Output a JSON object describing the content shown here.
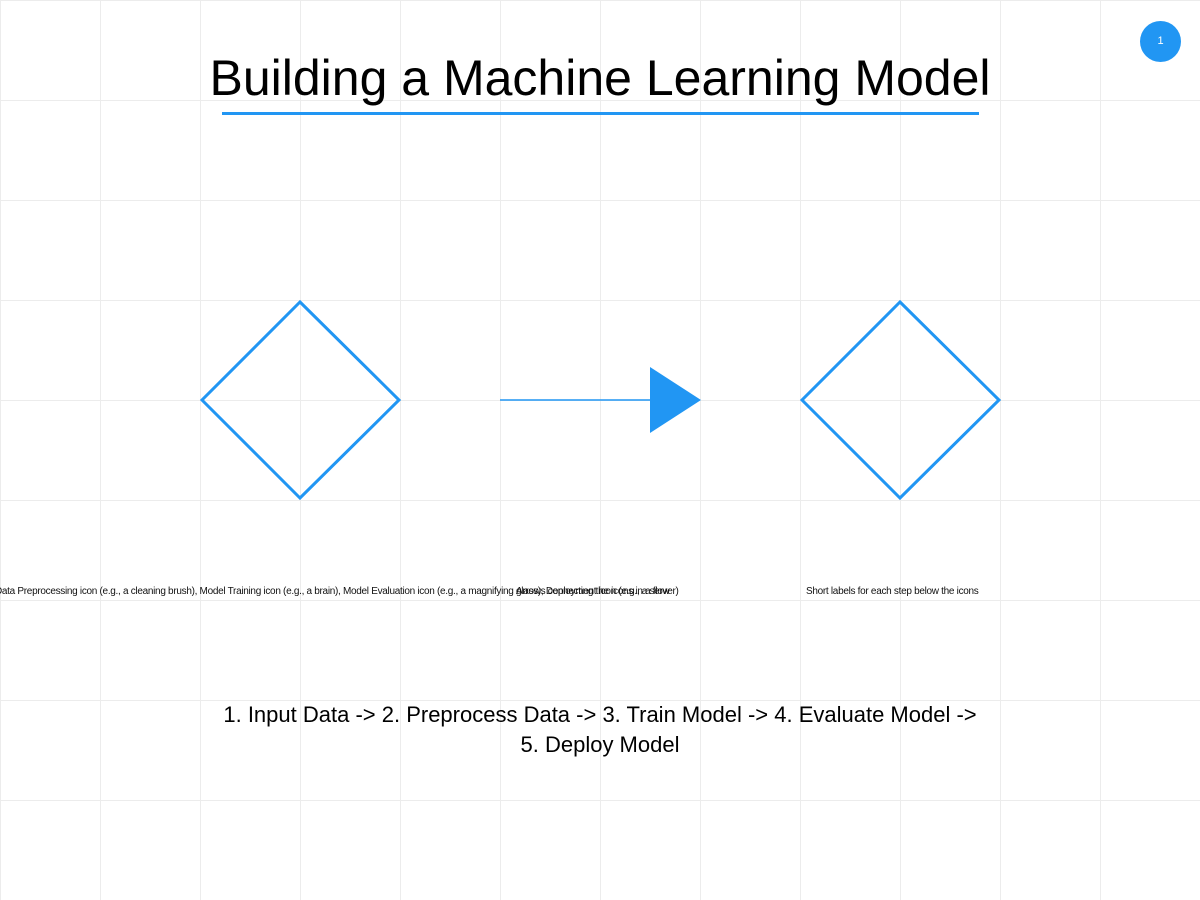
{
  "page": {
    "title": "Building a Machine Learning Model",
    "page_number": "1",
    "accent_color": "#2196f3"
  },
  "diagram": {
    "shapes": [
      {
        "name": "diamond-left",
        "kind": "diamond"
      },
      {
        "name": "arrow-right",
        "kind": "arrow"
      },
      {
        "name": "diamond-right",
        "kind": "diamond"
      }
    ],
    "captions": {
      "left": "Data Preprocessing icon (e.g., a cleaning brush), Model Training icon (e.g., a brain), Model Evaluation icon (e.g., a magnifying glass), Deployment icon (e.g., a server)",
      "middle": "Arrows connecting the icons in a flow",
      "right": "Short labels for each step below the icons"
    }
  },
  "flow": {
    "line1": "1. Input Data -> 2. Preprocess Data -> 3. Train Model -> 4. Evaluate Model ->",
    "line2": "5. Deploy Model"
  }
}
